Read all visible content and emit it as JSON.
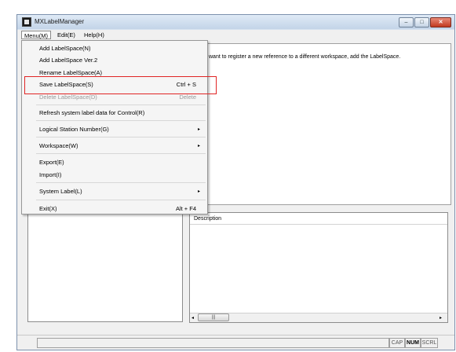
{
  "window": {
    "title": "MXLabelManager",
    "controls": {
      "minimize": "–",
      "maximize": "□",
      "close": "✕"
    }
  },
  "menubar": {
    "items": [
      "Menu(M)",
      "Edit(E)",
      "Help(H)"
    ]
  },
  "dropdown": {
    "items": [
      {
        "label": "Add LabelSpace(N)"
      },
      {
        "label": "Add LabelSpace Ver.2"
      },
      {
        "label": "Rename LabelSpace(A)"
      },
      {
        "label": "Save LabelSpace(S)",
        "shortcut": "Ctrl + S"
      },
      {
        "label": "Delete LabelSpace(D)",
        "shortcut": "Delete",
        "disabled": true
      },
      {
        "label": "Refresh system label data for Control(R)"
      },
      {
        "label": "Logical Station Number(G)",
        "submenu": true
      },
      {
        "label": "Workspace(W)",
        "submenu": true
      },
      {
        "label": "Export(E)"
      },
      {
        "label": "Import(I)"
      },
      {
        "label": "System Label(L)",
        "submenu": true
      },
      {
        "label": "Exit(X)",
        "shortcut": "Alt + F4"
      }
    ],
    "submenu_arrow": "▸"
  },
  "info": {
    "text": "want to register a new reference to a different workspace, add the LabelSpace."
  },
  "description_panel": {
    "header": "Description",
    "scroll_left": "◂",
    "scroll_right": "▸",
    "scroll_thumb": "|||"
  },
  "statusbar": {
    "indicators": [
      "CAP",
      "NUM",
      "SCRL"
    ]
  },
  "colors": {
    "highlight_border": "#e02424",
    "close_button": "#c1391f"
  }
}
